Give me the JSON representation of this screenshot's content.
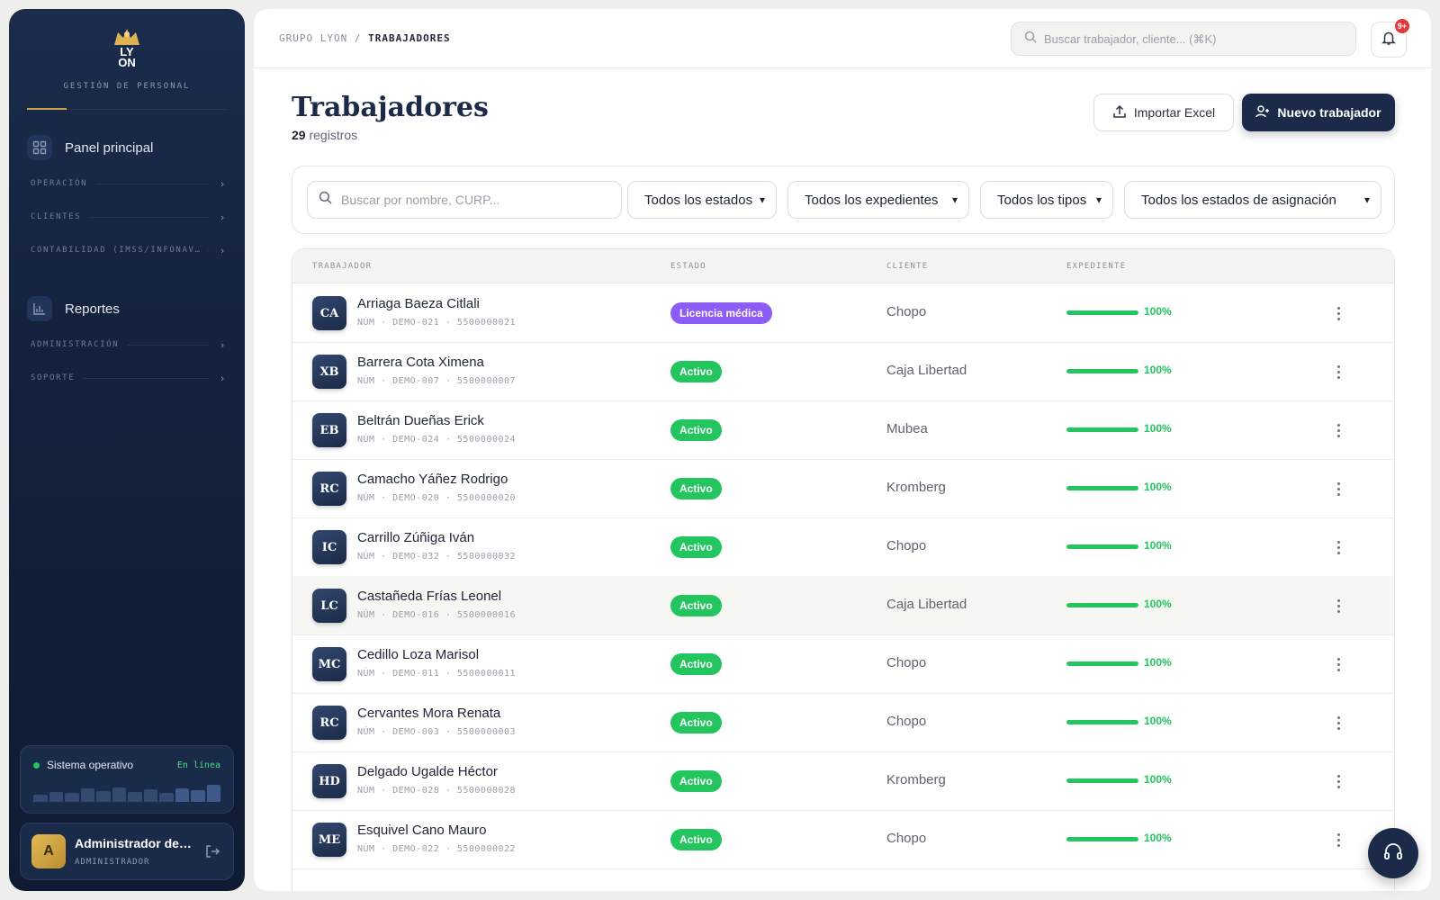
{
  "brand": {
    "logo_letters_1": "LY",
    "logo_letters_2": "ON",
    "subtitle": "GESTIÓN DE PERSONAL",
    "accent_color": "#c9a24a"
  },
  "sidebar": {
    "panel_label": "Panel principal",
    "reports_label": "Reportes",
    "sections": [
      {
        "label": "OPERACIÓN"
      },
      {
        "label": "CLIENTES"
      },
      {
        "label": "CONTABILIDAD (IMSS/INFONAV…"
      },
      {
        "label": "ADMINISTRACIÓN"
      },
      {
        "label": "SOPORTE"
      }
    ],
    "status": {
      "label": "Sistema operativo",
      "online": "En línea",
      "bar_levels": [
        0.35,
        0.5,
        0.45,
        0.7,
        0.55,
        0.75,
        0.5,
        0.65,
        0.45,
        0.7,
        0.6,
        0.85
      ]
    },
    "user": {
      "initial": "A",
      "name": "Administrador del Sistema",
      "role": "ADMINISTRADOR"
    }
  },
  "header": {
    "breadcrumb_root": "GRUPO LYON",
    "breadcrumb_sep": "/",
    "breadcrumb_current": "TRABAJADORES",
    "search_placeholder": "Buscar trabajador, cliente... (⌘K)",
    "notification_badge": "9+"
  },
  "page": {
    "title": "Trabajadores",
    "count": "29",
    "count_suffix": "registros",
    "import_label": "Importar Excel",
    "new_label": "Nuevo trabajador"
  },
  "filters": {
    "search_placeholder": "Buscar por nombre, CURP...",
    "estados": "Todos los estados",
    "expedientes": "Todos los expedientes",
    "tipos": "Todos los tipos",
    "asignacion": "Todos los estados de asignación"
  },
  "table": {
    "columns": [
      "TRABAJADOR",
      "ESTADO",
      "CLIENTE",
      "EXPEDIENTE"
    ],
    "rows": [
      {
        "initials": "CA",
        "name": "Arriaga Baeza Citlali",
        "sub": "NÚM · DEMO-021 · 5500000021",
        "state": "Licencia médica",
        "state_color": "#8b5cf6",
        "client": "Chopo",
        "progress": 100,
        "progress_label": "100%"
      },
      {
        "initials": "XB",
        "name": "Barrera Cota Ximena",
        "sub": "NÚM · DEMO-007 · 5500000007",
        "state": "Activo",
        "state_color": "#22c55e",
        "client": "Caja Libertad",
        "progress": 100,
        "progress_label": "100%"
      },
      {
        "initials": "EB",
        "name": "Beltrán Dueñas Erick",
        "sub": "NÚM · DEMO-024 · 5500000024",
        "state": "Activo",
        "state_color": "#22c55e",
        "client": "Mubea",
        "progress": 100,
        "progress_label": "100%"
      },
      {
        "initials": "RC",
        "name": "Camacho Yáñez Rodrigo",
        "sub": "NÚM · DEMO-020 · 5500000020",
        "state": "Activo",
        "state_color": "#22c55e",
        "client": "Kromberg",
        "progress": 100,
        "progress_label": "100%"
      },
      {
        "initials": "IC",
        "name": "Carrillo Zúñiga Iván",
        "sub": "NÚM · DEMO-032 · 5500000032",
        "state": "Activo",
        "state_color": "#22c55e",
        "client": "Chopo",
        "progress": 100,
        "progress_label": "100%"
      },
      {
        "initials": "LC",
        "name": "Castañeda Frías Leonel",
        "sub": "NÚM · DEMO-016 · 5500000016",
        "state": "Activo",
        "state_color": "#22c55e",
        "client": "Caja Libertad",
        "progress": 100,
        "progress_label": "100%"
      },
      {
        "initials": "MC",
        "name": "Cedillo Loza Marisol",
        "sub": "NÚM · DEMO-011 · 5500000011",
        "state": "Activo",
        "state_color": "#22c55e",
        "client": "Chopo",
        "progress": 100,
        "progress_label": "100%"
      },
      {
        "initials": "RC",
        "name": "Cervantes Mora Renata",
        "sub": "NÚM · DEMO-003 · 5500000003",
        "state": "Activo",
        "state_color": "#22c55e",
        "client": "Chopo",
        "progress": 100,
        "progress_label": "100%"
      },
      {
        "initials": "HD",
        "name": "Delgado Ugalde Héctor",
        "sub": "NÚM · DEMO-028 · 5500000028",
        "state": "Activo",
        "state_color": "#22c55e",
        "client": "Kromberg",
        "progress": 100,
        "progress_label": "100%"
      },
      {
        "initials": "ME",
        "name": "Esquivel Cano Mauro",
        "sub": "NÚM · DEMO-022 · 5500000022",
        "state": "Activo",
        "state_color": "#22c55e",
        "client": "Chopo",
        "progress": 100,
        "progress_label": "100%"
      }
    ]
  }
}
